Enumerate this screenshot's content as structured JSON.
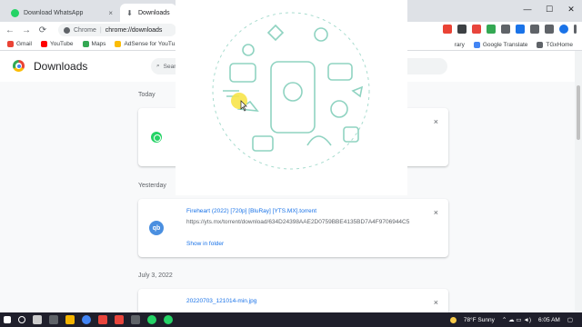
{
  "tabs": [
    {
      "title": "Download WhatsApp",
      "close": "×"
    },
    {
      "title": "Downloads",
      "close": "×"
    }
  ],
  "tab_plus": "+",
  "window_controls": [
    "—",
    "☐",
    "✕"
  ],
  "toolbar": {
    "back": "←",
    "forward": "→",
    "reload": "⟳",
    "site": "Chrome",
    "separator": "|",
    "url": "chrome://downloads"
  },
  "bookmarks_left": [
    {
      "label": "Gmail",
      "color": "#ea4335"
    },
    {
      "label": "YouTube",
      "color": "#ff0000"
    },
    {
      "label": "Maps",
      "color": "#34a853"
    },
    {
      "label": "AdSense for YouTu...",
      "color": "#fbbc05"
    }
  ],
  "bookmarks_right": [
    {
      "label": "rary",
      "color": "#5f6368"
    },
    {
      "label": "Google Translate",
      "color": "#4285f4"
    },
    {
      "label": "TGxHome",
      "color": "#5f6368"
    }
  ],
  "downloads_page": {
    "title": "Downloads",
    "search_placeholder": "Searc",
    "sections": [
      {
        "date": "Today"
      },
      {
        "date": "Yesterday"
      },
      {
        "date": "July 3, 2022"
      }
    ],
    "items": [
      {
        "filename": "Fireheart (2022) [720p] [BluRay] [YTS.MX].torrent",
        "url": "https://yts.mx/torrent/download/634D24398AAE2D0759BBE4135BD7A4F9706944C5",
        "action": "Show in folder",
        "icon_text": "qb"
      },
      {
        "filename": "20220703_121014-min.jpg"
      }
    ],
    "close_glyph": "×"
  },
  "taskbar": {
    "weather": "78°F  Sunny",
    "time": "6:05 AM",
    "colors": [
      "#1f1f2b",
      "#25d366",
      "#4285f4"
    ]
  },
  "brand": {
    "whatsapp_green": "#25d366",
    "link_blue": "#1a73e8"
  }
}
